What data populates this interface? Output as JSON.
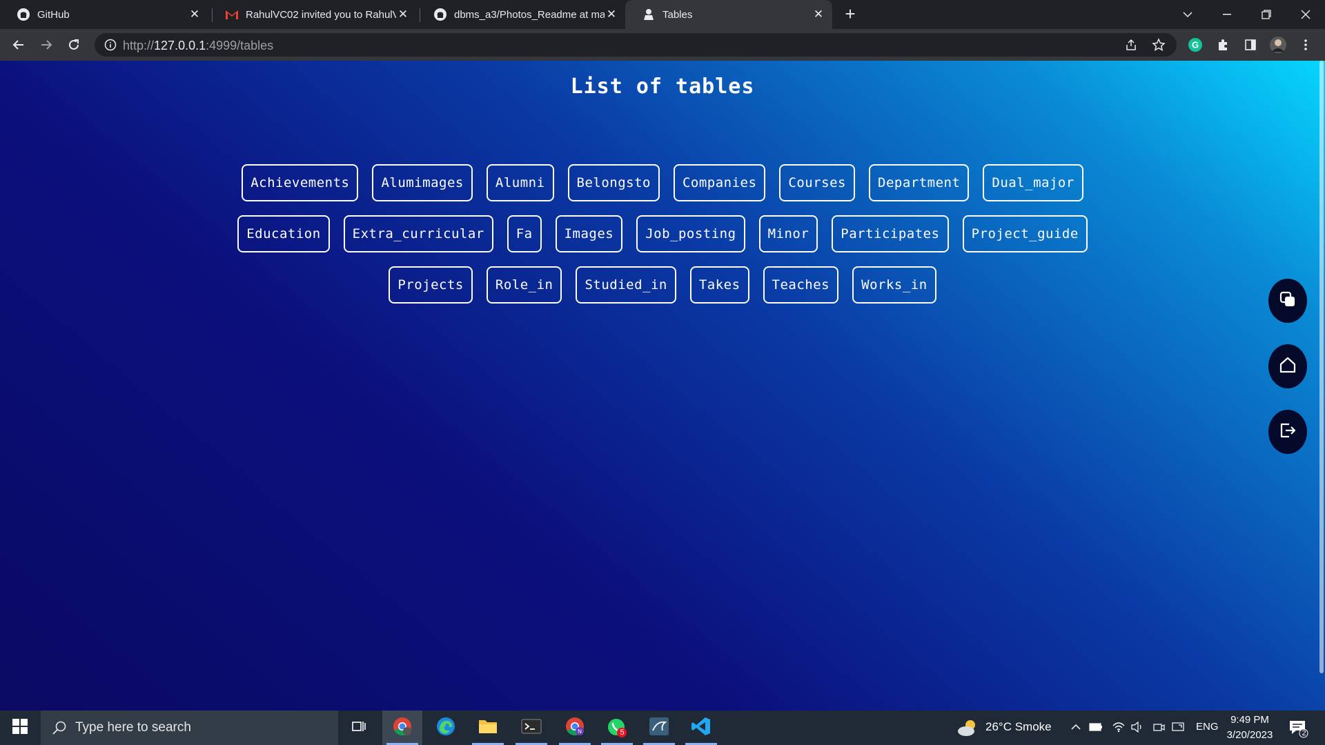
{
  "browser": {
    "tabs": [
      {
        "title": "GitHub",
        "icon": "github-icon"
      },
      {
        "title": "RahulVC02 invited you to RahulV",
        "icon": "gmail-icon"
      },
      {
        "title": "dbms_a3/Photos_Readme at mai",
        "icon": "github-icon"
      },
      {
        "title": "Tables",
        "icon": "app-favicon"
      }
    ],
    "new_tab": "+",
    "address": {
      "scheme": "http://",
      "host": "127.0.0.1",
      "rest": ":4999/tables"
    }
  },
  "page": {
    "title": "List of tables",
    "rows": [
      [
        "Achievements",
        "Alumimages",
        "Alumni",
        "Belongsto",
        "Companies",
        "Courses",
        "Department",
        "Dual_major"
      ],
      [
        "Education",
        "Extra_curricular",
        "Fa",
        "Images",
        "Job_posting",
        "Minor",
        "Participates",
        "Project_guide"
      ],
      [
        "Projects",
        "Role_in",
        "Studied_in",
        "Takes",
        "Teaches",
        "Works_in"
      ]
    ],
    "fab_icons": [
      "copy-icon",
      "home-icon",
      "logout-icon"
    ]
  },
  "taskbar": {
    "search_placeholder": "Type here to search",
    "weather": "26°C  Smoke",
    "language": "ENG",
    "time": "9:49 PM",
    "date": "3/20/2023",
    "whatsapp_badge": "5",
    "notification_count": "2"
  },
  "colors": {
    "gradient_dark": "#0a0a63",
    "gradient_light": "#06d6ff",
    "fab_bg": "#050a2a"
  }
}
